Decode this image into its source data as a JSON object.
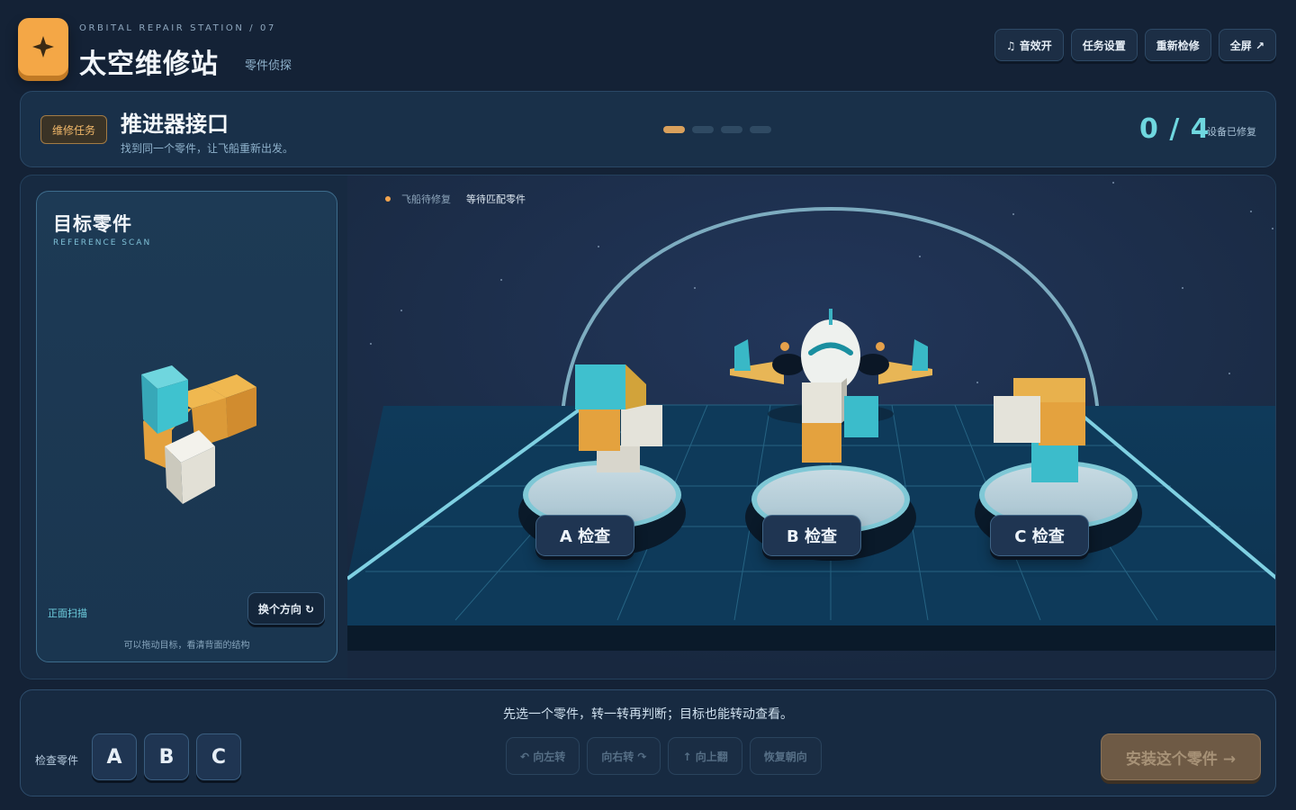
{
  "header": {
    "subtitle_en": "ORBITAL REPAIR STATION / 07",
    "title": "太空维修站",
    "subtitle": "零件侦探",
    "buttons": [
      "♫ 音效开",
      "任务设置",
      "重新检修",
      "全屏 ↗"
    ]
  },
  "mission": {
    "badge": "维修任务",
    "title": "推进器接口",
    "description": "找到同一个零件，让飞船重新出发。",
    "progress_total": 4,
    "progress_current": 1,
    "score": "0 / 4",
    "score_label": "设备已修复"
  },
  "reference": {
    "title": "目标零件",
    "subtitle": "REFERENCE SCAN",
    "view_label": "正面扫描",
    "rotate_button": "换个方向 ↻",
    "hint": "可以拖动目标，看清背面的结构"
  },
  "scene": {
    "legend_status": "飞船待修复",
    "legend_state": "等待匹配零件",
    "check_buttons": [
      "A 检查",
      "B 检查",
      "C 检查"
    ]
  },
  "controls": {
    "instruction": "先选一个零件，转一转再判断；目标也能转动查看。",
    "compare_label": "检查零件",
    "pieces": [
      "A",
      "B",
      "C"
    ],
    "actions": [
      "↶ 向左转",
      "向右转 ↷",
      "↑ 向上翻",
      "恢复朝向"
    ],
    "install": "安装这个零件 →"
  },
  "colors": {
    "accent_teal": "#6fd7df",
    "accent_orange": "#f4a746",
    "cube_teal": "#3cbccb",
    "cube_orange": "#e4a23e",
    "cube_white": "#e4e3da",
    "panel_bg": "#172a41"
  }
}
